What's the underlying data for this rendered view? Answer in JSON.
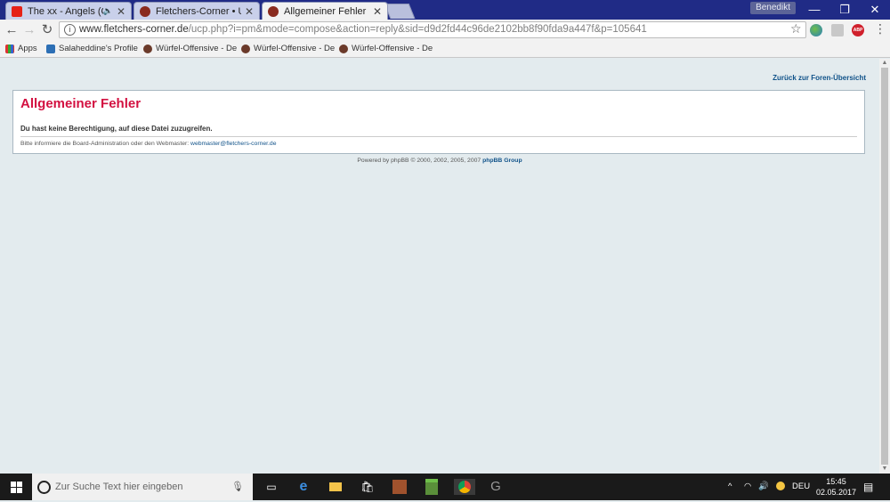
{
  "browser": {
    "tabs": [
      {
        "title": "The xx - Angels (Offic",
        "audio": "🔈",
        "close": "✕"
      },
      {
        "title": "Fletchers-Corner • Unge",
        "close": "✕"
      },
      {
        "title": "Allgemeiner Fehler",
        "close": "✕"
      }
    ],
    "profile_name": "Benedikt",
    "window_controls": {
      "minimize": "—",
      "restore": "❐",
      "close": "✕"
    },
    "nav": {
      "back": "←",
      "forward": "→",
      "reload": "↻"
    },
    "url_host": "www.fletchers-corner.de",
    "url_path": "/ucp.php?i=pm&mode=compose&action=reply&sid=d9d2fd44c96de2102bb8f90fda9a447f&p=105641",
    "info_glyph": "i",
    "bookmark_star": "☆",
    "menu": "⋮",
    "extension_abp": "ABP",
    "bookmarks": [
      {
        "label": "Apps"
      },
      {
        "label": "Salaheddine's Profile"
      },
      {
        "label": "Würfel-Offensive - De"
      },
      {
        "label": "Würfel-Offensive - De"
      },
      {
        "label": "Würfel-Offensive - De"
      }
    ]
  },
  "page": {
    "back_link": "Zurück zur Foren-Übersicht",
    "error_title": "Allgemeiner Fehler",
    "error_message": "Du hast keine Berechtigung, auf diese Datei zuzugreifen.",
    "note_prefix": "Bitte informiere die Board-Administration oder den Webmaster:",
    "webmaster_email": "webmaster@fletchers-corner.de",
    "footer_prefix": "Powered by phpBB © 2000, 2002, 2005, 2007",
    "footer_link": "phpBB Group"
  },
  "taskbar": {
    "search_placeholder": "Zur Suche Text hier eingeben",
    "language": "DEU",
    "time": "15:45",
    "date": "02.05.2017"
  },
  "colors": {
    "error_title": "#d31141",
    "link": "#105289",
    "page_bg": "#e3ebee",
    "tabstrip": "#202b86"
  }
}
